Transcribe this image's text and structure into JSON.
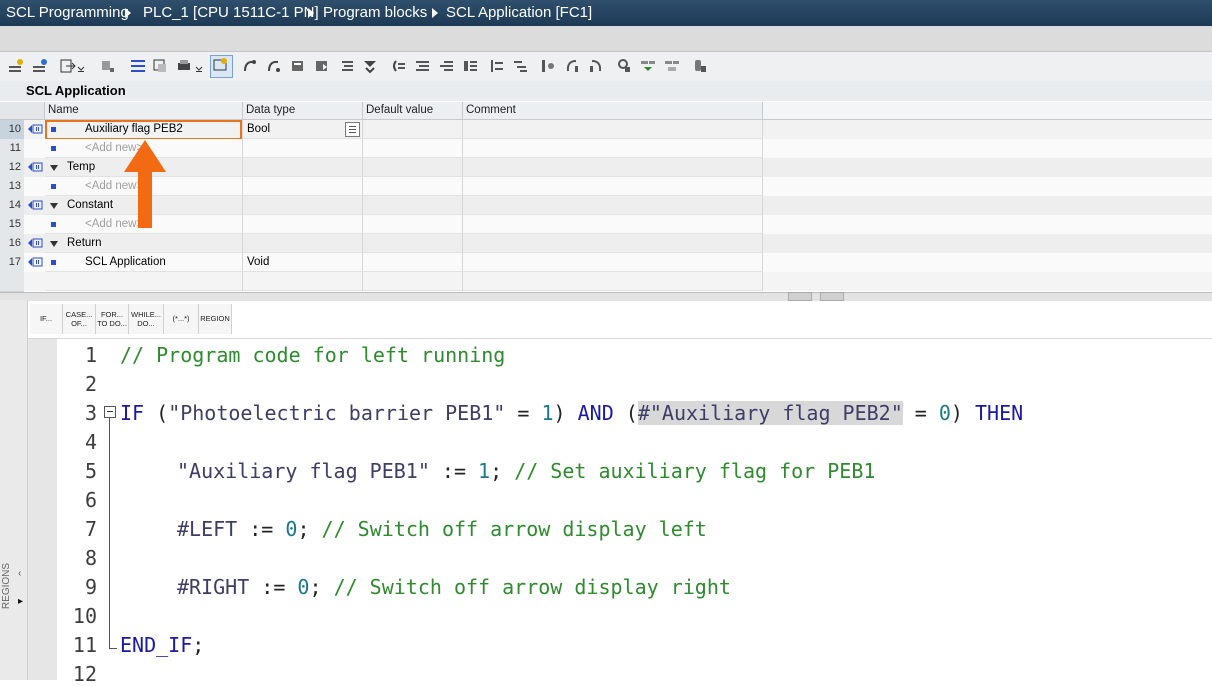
{
  "breadcrumb": {
    "items": [
      "SCL Programming",
      "PLC_1 [CPU 1511C-1 PN]",
      "Program blocks",
      "SCL Application [FC1]"
    ]
  },
  "block": {
    "name": "SCL Application"
  },
  "interface": {
    "columns": [
      "Name",
      "Data type",
      "Default value",
      "Comment"
    ],
    "rows": [
      {
        "num": "10",
        "name": "Auxiliary flag PEB2",
        "type": "Bool"
      },
      {
        "num": "11",
        "name": "<Add new>",
        "type": ""
      },
      {
        "num": "12",
        "name": "Temp",
        "type": ""
      },
      {
        "num": "13",
        "name": "<Add new>",
        "type": ""
      },
      {
        "num": "14",
        "name": "Constant",
        "type": ""
      },
      {
        "num": "15",
        "name": "<Add new>",
        "type": ""
      },
      {
        "num": "16",
        "name": "Return",
        "type": ""
      },
      {
        "num": "17",
        "name": "SCL Application",
        "type": "Void"
      }
    ]
  },
  "snippets": {
    "if": "IF...",
    "case": "CASE... OF...",
    "for": "FOR... TO DO...",
    "while": "WHILE... DO...",
    "comment": "(*...*)",
    "region": "REGION"
  },
  "regions_label": "REGIONS",
  "code": {
    "line_numbers": [
      "1",
      "2",
      "3",
      "4",
      "5",
      "6",
      "7",
      "8",
      "9",
      "10",
      "11",
      "12"
    ],
    "l1_comment": "// Program code for left running",
    "l3_if": "IF",
    "l3_open": " (",
    "l3_str1": "\"Photoelectric barrier PEB1\"",
    "l3_eq1": " = ",
    "l3_num1": "1",
    "l3_close1": ") ",
    "l3_and": "AND",
    "l3_open2": " (",
    "l3_str2": "#\"Auxiliary flag PEB2\"",
    "l3_eq2": " = ",
    "l3_num2": "0",
    "l3_close2": ") ",
    "l3_then": "THEN",
    "l5_str": "\"Auxiliary flag PEB1\"",
    "l5_assign": " := ",
    "l5_num": "1",
    "l5_semi": "; ",
    "l5_comment": "// Set auxiliary flag for PEB1",
    "l7_var": "#LEFT",
    "l7_assign": " := ",
    "l7_num": "0",
    "l7_semi": "; ",
    "l7_comment": "// Switch off arrow display left",
    "l9_var": "#RIGHT",
    "l9_assign": " := ",
    "l9_num": "0",
    "l9_semi": "; ",
    "l9_comment": "// Switch off arrow display right",
    "l11_end": "END_IF",
    "l11_semi": ";"
  },
  "colors": {
    "highlight_border": "#e8741c",
    "arrow": "#f26b12",
    "keyword": "#1a1aa6",
    "comment": "#2e8b2e"
  }
}
